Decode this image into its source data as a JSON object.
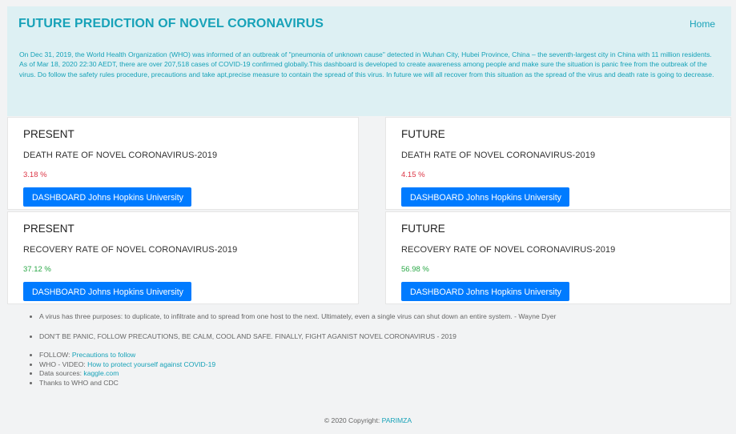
{
  "navbar": {
    "brand": "FUTURE PREDICTION OF NOVEL CORONAVIRUS",
    "home": "Home"
  },
  "intro": "On Dec 31, 2019, the World Health Organization (WHO) was informed of an outbreak of \"pneumonia of unknown cause\" detected in Wuhan City, Hubei Province, China – the seventh-largest city in China with 11 million residents. As of Mar 18, 2020 22:30 AEDT, there are over 207,518 cases of COVID-19 confirmed globally.This dashboard is developed to create awareness among people and make sure the situation is panic free from the outbreak of the virus. Do follow the safety rules procedure, precautions and take apt,precise measure to contain the spread of this virus. In future we will all recover from this situation as the spread of the virus and death rate is going to decrease.",
  "cards": {
    "present_death": {
      "title": "PRESENT",
      "subtitle": "DEATH RATE OF NOVEL CORONAVIRUS-2019",
      "value": "3.18 %",
      "button": "DASHBOARD Johns Hopkins University"
    },
    "future_death": {
      "title": "FUTURE",
      "subtitle": "DEATH RATE OF NOVEL CORONAVIRUS-2019",
      "value": "4.15 %",
      "button": "DASHBOARD Johns Hopkins University"
    },
    "present_recovery": {
      "title": "PRESENT",
      "subtitle": "RECOVERY RATE OF NOVEL CORONAVIRUS-2019",
      "value": "37.12 %",
      "button": "DASHBOARD Johns Hopkins University"
    },
    "future_recovery": {
      "title": "FUTURE",
      "subtitle": "RECOVERY RATE OF NOVEL CORONAVIRUS-2019",
      "value": "56.98 %",
      "button": "DASHBOARD Johns Hopkins University"
    }
  },
  "footer": {
    "quote": "A virus has three purposes: to duplicate, to infiltrate and to spread from one host to the next. Ultimately, even a single virus can shut down an entire system. - Wayne Dyer",
    "advice": "DON'T BE PANIC, FOLLOW PRECAUTIONS, BE CALM, COOL AND SAFE. FINALLY, FIGHT AGANIST NOVEL CORONAVIRUS - 2019",
    "follow_label": "FOLLOW: ",
    "follow_link": "Precautions to follow",
    "who_label": "WHO - VIDEO: ",
    "who_link": "How to protect yourself against COVID-19",
    "data_label": "Data sources: ",
    "data_link": "kaggle.com",
    "thanks": "Thanks to WHO and CDC"
  },
  "copyright": {
    "text": "© 2020 Copyright: ",
    "link": "PARIMZA"
  },
  "colors": {
    "accent": "#17a2b8",
    "button": "#007bff",
    "death": "#dc3545",
    "recovery": "#28a745"
  }
}
